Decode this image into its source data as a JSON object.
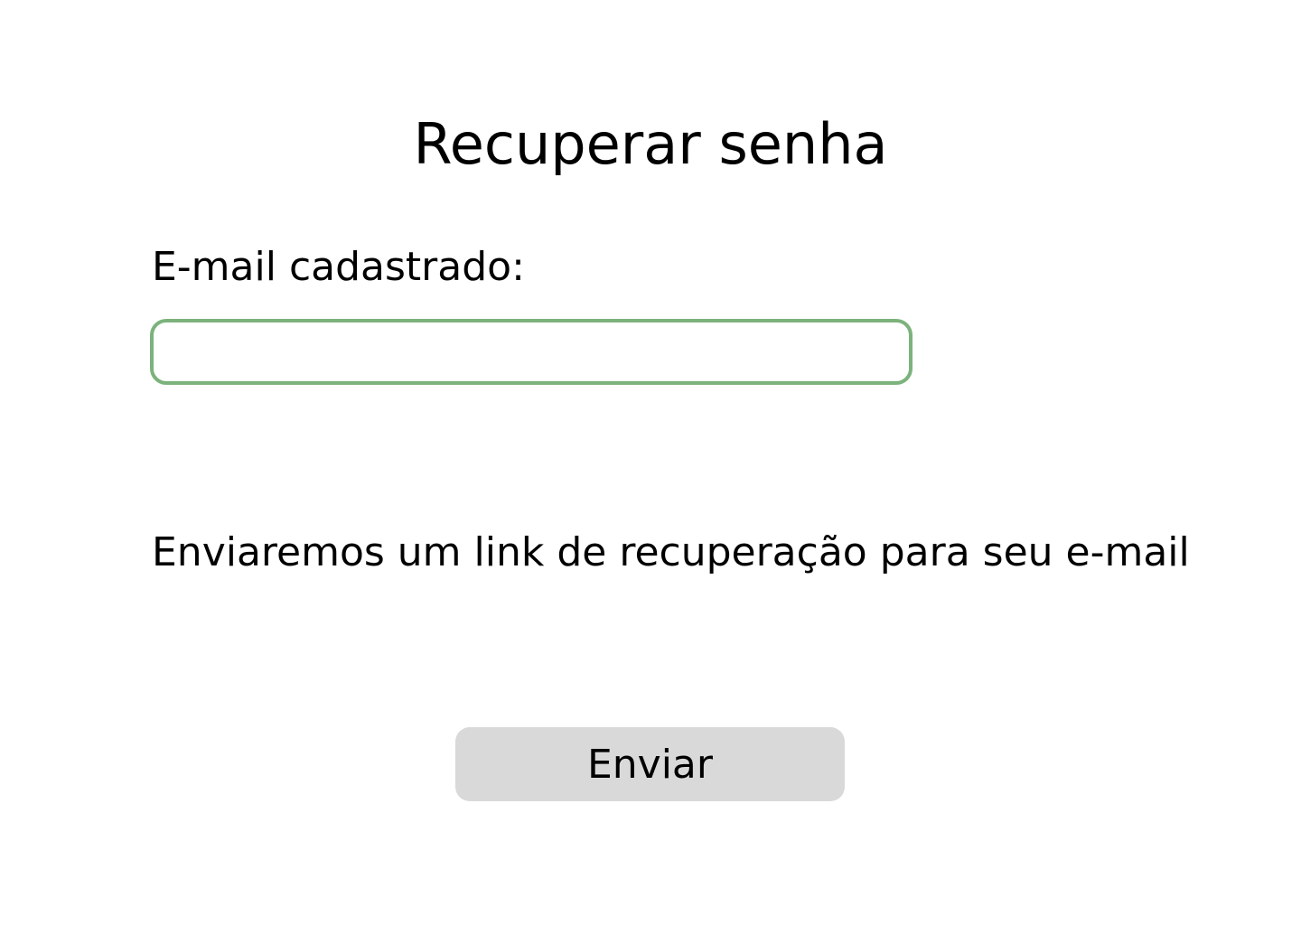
{
  "page": {
    "title": "Recuperar senha"
  },
  "form": {
    "email_label": "E-mail cadastrado:",
    "email_value": "",
    "email_placeholder": "",
    "info_text": "Enviaremos um link de recuperação para seu e-mail",
    "submit_label": "Enviar"
  },
  "colors": {
    "input_border": "#7cb27c",
    "button_background": "#d9d9d9",
    "text": "#000000",
    "background": "#ffffff"
  }
}
